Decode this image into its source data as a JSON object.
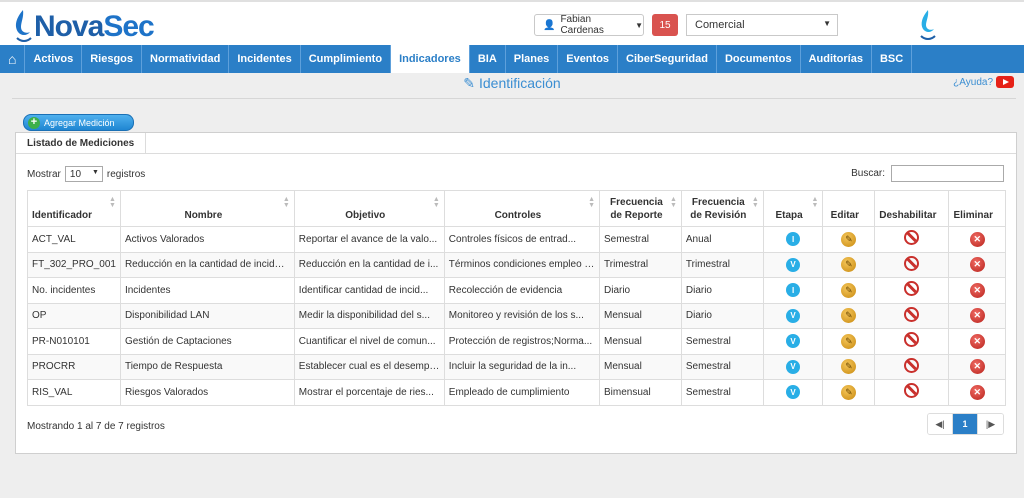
{
  "header": {
    "logo": "NovaSec",
    "user_name": "Fabian Cardenas",
    "notifications": "15",
    "company": "Comercial"
  },
  "nav": [
    {
      "label": "Activos"
    },
    {
      "label": "Riesgos"
    },
    {
      "label": "Normatividad"
    },
    {
      "label": "Incidentes"
    },
    {
      "label": "Cumplimiento"
    },
    {
      "label": "Indicadores",
      "active": true
    },
    {
      "label": "BIA"
    },
    {
      "label": "Planes"
    },
    {
      "label": "Eventos"
    },
    {
      "label": "CiberSeguridad"
    },
    {
      "label": "Documentos"
    },
    {
      "label": "Auditorías"
    },
    {
      "label": "BSC"
    }
  ],
  "page": {
    "title": "Identificación",
    "help": "¿Ayuda?"
  },
  "add_button": "Agregar Medición",
  "panel": {
    "title": "Listado de Mediciones",
    "show_label": "Mostrar",
    "show_value": "10",
    "records_label": "registros",
    "search_label": "Buscar:",
    "info": "Mostrando 1 al 7 de 7 registros",
    "current_page": "1"
  },
  "table": {
    "headers": {
      "id": "Identificador",
      "nombre": "Nombre",
      "objetivo": "Objetivo",
      "controles": "Controles",
      "frec_reporte": "Frecuencia de Reporte",
      "frec_revision": "Frecuencia de Revisión",
      "etapa": "Etapa",
      "editar": "Editar",
      "deshabilitar": "Deshabilitar",
      "eliminar": "Eliminar"
    },
    "rows": [
      {
        "id": "ACT_VAL",
        "nombre": "Activos Valorados",
        "objetivo": "Reportar el avance de la valo...",
        "controles": "Controles físicos de entrad...",
        "frec_reporte": "Semestral",
        "frec_revision": "Anual",
        "etapa": "I"
      },
      {
        "id": "FT_302_PRO_001",
        "nombre": "Reducción en la cantidad de incidentes",
        "objetivo": "Reducción en la cantidad de i...",
        "controles": "Términos condiciones empleo y...",
        "frec_reporte": "Trimestral",
        "frec_revision": "Trimestral",
        "etapa": "V"
      },
      {
        "id": "No. incidentes",
        "nombre": "Incidentes",
        "objetivo": "Identificar cantidad de incid...",
        "controles": "Recolección de evidencia",
        "frec_reporte": "Diario",
        "frec_revision": "Diario",
        "etapa": "I"
      },
      {
        "id": "OP",
        "nombre": "Disponibilidad LAN",
        "objetivo": "Medir la disponibilidad del s...",
        "controles": "Monitoreo y revisión de los s...",
        "frec_reporte": "Mensual",
        "frec_revision": "Diario",
        "etapa": "V"
      },
      {
        "id": "PR-N010101",
        "nombre": "Gestión de Captaciones",
        "objetivo": "Cuantificar el nivel de comun...",
        "controles": "Protección de registros;Norma...",
        "frec_reporte": "Mensual",
        "frec_revision": "Semestral",
        "etapa": "V"
      },
      {
        "id": "PROCRR",
        "nombre": "Tiempo de Respuesta",
        "objetivo": "Establecer cual es el desempe...",
        "controles": "Incluir la seguridad de la in...",
        "frec_reporte": "Mensual",
        "frec_revision": "Semestral",
        "etapa": "V"
      },
      {
        "id": "RIS_VAL",
        "nombre": "Riesgos Valorados",
        "objetivo": "Mostrar el porcentaje de ries...",
        "controles": "Empleado de cumplimiento",
        "frec_reporte": "Bimensual",
        "frec_revision": "Semestral",
        "etapa": "V"
      }
    ]
  },
  "colors": {
    "nav": "#2b7fc7",
    "accent": "#3b8ed2",
    "danger": "#c9302c",
    "etapa": "#29aee6"
  },
  "icons": {
    "home": "home-icon",
    "user": "user-icon",
    "edit": "pencil-icon",
    "disable": "ban-icon",
    "delete": "delete-icon",
    "help": "youtube-icon"
  }
}
